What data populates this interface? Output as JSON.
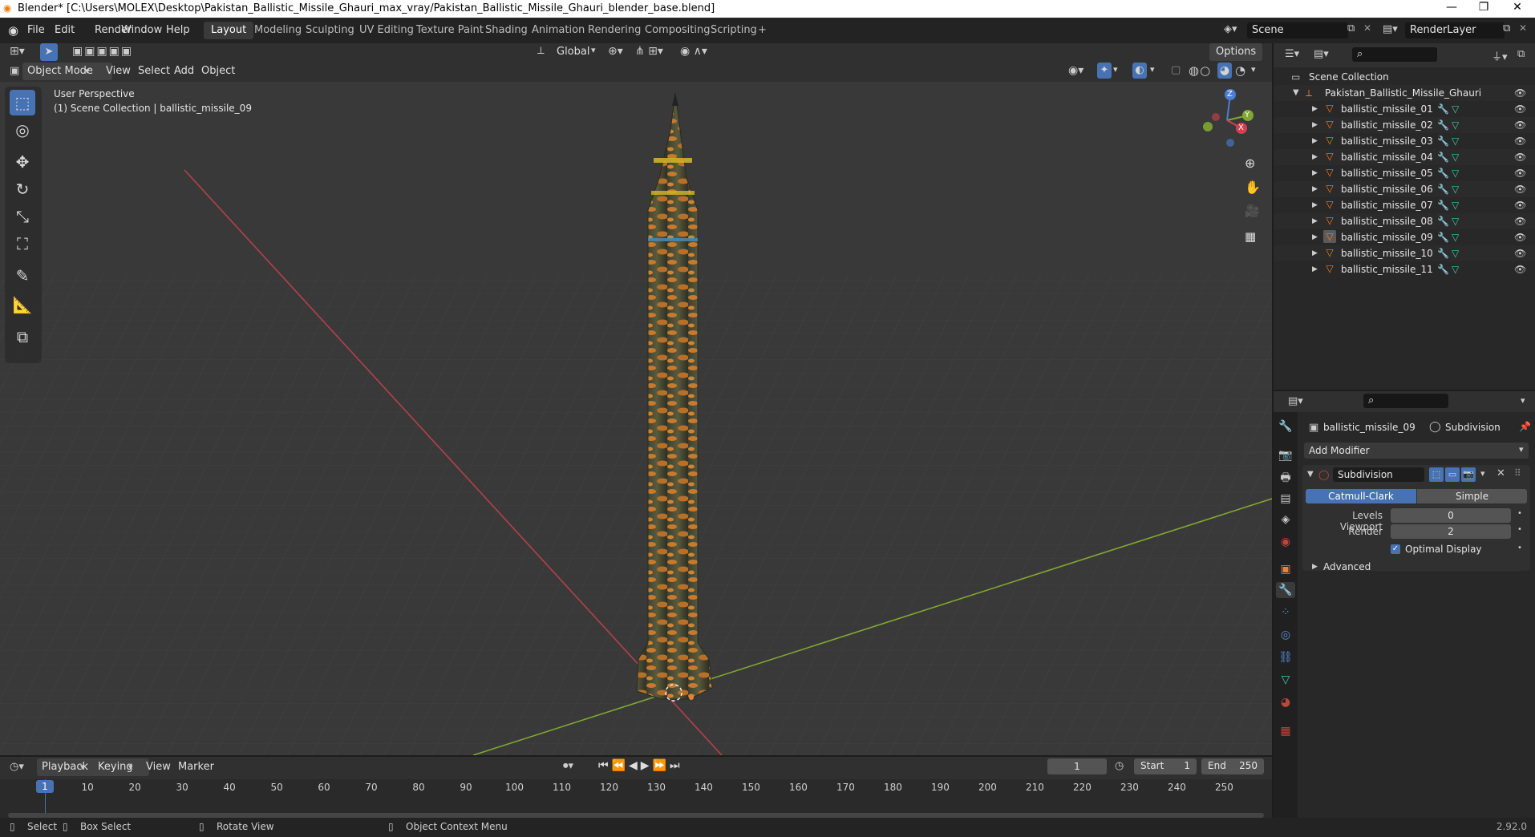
{
  "window": {
    "title": "Blender* [C:\\Users\\MOLEX\\Desktop\\Pakistan_Ballistic_Missile_Ghauri_max_vray/Pakistan_Ballistic_Missile_Ghauri_blender_base.blend]",
    "minimize": "—",
    "maximize": "❐",
    "close": "✕"
  },
  "menubar": {
    "items": [
      "File",
      "Edit",
      "Render",
      "Window",
      "Help"
    ],
    "workspaces": [
      "Layout",
      "Modeling",
      "Sculpting",
      "UV Editing",
      "Texture Paint",
      "Shading",
      "Animation",
      "Rendering",
      "Compositing",
      "Scripting"
    ],
    "active_workspace": "Layout",
    "add_workspace": "+",
    "scene": "Scene",
    "render_layer": "RenderLayer"
  },
  "viewport_header": {
    "mode": "Object Mode",
    "menus": [
      "View",
      "Select",
      "Add",
      "Object"
    ],
    "orientation": "Global",
    "options": "Options"
  },
  "viewport": {
    "perspective": "User Perspective",
    "collection_info": "(1) Scene Collection | ballistic_missile_09",
    "gizmo": {
      "z": "Z",
      "y": "Y",
      "x": "X"
    }
  },
  "outliner": {
    "root": "Scene Collection",
    "collection": "Pakistan_Ballistic_Missile_Ghauri",
    "objects": [
      "ballistic_missile_01",
      "ballistic_missile_02",
      "ballistic_missile_03",
      "ballistic_missile_04",
      "ballistic_missile_05",
      "ballistic_missile_06",
      "ballistic_missile_07",
      "ballistic_missile_08",
      "ballistic_missile_09",
      "ballistic_missile_10",
      "ballistic_missile_11"
    ],
    "selected": "ballistic_missile_09"
  },
  "properties": {
    "object_name": "ballistic_missile_09",
    "modifier_crumb": "Subdivision",
    "add_modifier": "Add Modifier",
    "modifier": {
      "name": "Subdivision",
      "type_options": [
        "Catmull-Clark",
        "Simple"
      ],
      "active_type": "Catmull-Clark",
      "levels_viewport_label": "Levels Viewport",
      "levels_viewport": "0",
      "render_label": "Render",
      "render": "2",
      "optimal_display_label": "Optimal Display",
      "optimal_display": true,
      "advanced_label": "Advanced"
    }
  },
  "timeline": {
    "menus": [
      "Playback",
      "Keying",
      "View",
      "Marker"
    ],
    "current_frame": "1",
    "start_label": "Start",
    "start": "1",
    "end_label": "End",
    "end": "250",
    "ticks": [
      "1",
      "10",
      "20",
      "30",
      "40",
      "50",
      "60",
      "70",
      "80",
      "90",
      "100",
      "110",
      "120",
      "130",
      "140",
      "150",
      "160",
      "170",
      "180",
      "190",
      "200",
      "210",
      "220",
      "230",
      "240",
      "250"
    ]
  },
  "statusbar": {
    "select": "Select",
    "box_select": "Box Select",
    "rotate_view": "Rotate View",
    "context_menu": "Object Context Menu",
    "version": "2.92.0"
  },
  "colors": {
    "accent": "#4772b3",
    "object_orange": "#e8813a",
    "mesh_green": "#3ec9a7",
    "axis_red": "#b5404a",
    "axis_green": "#7fa732"
  }
}
